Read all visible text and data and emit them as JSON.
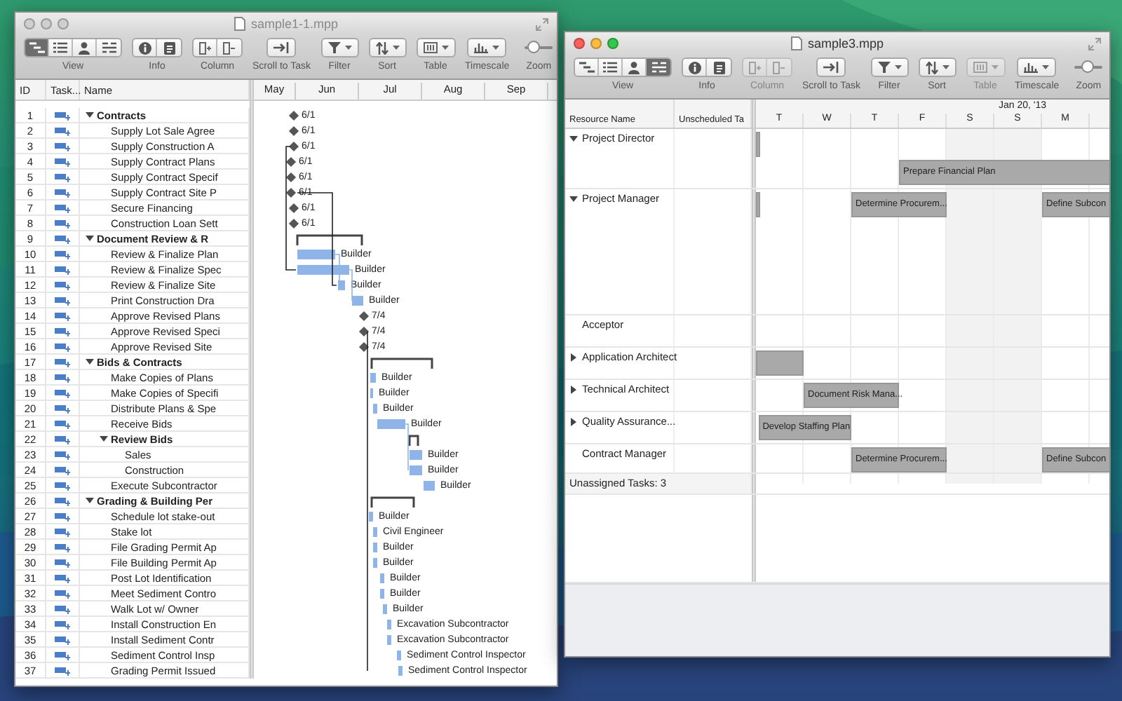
{
  "task_window": {
    "title": "sample1-1.mpp",
    "active": false,
    "toolbar": [
      {
        "kind": "view",
        "label": "View",
        "disabled": false,
        "segments": [
          {
            "selected": true
          },
          {
            "selected": false
          },
          {
            "selected": false
          },
          {
            "selected": false
          }
        ]
      },
      {
        "kind": "info",
        "label": "Info",
        "disabled": false
      },
      {
        "kind": "column",
        "label": "Column",
        "disabled": false
      },
      {
        "kind": "scroll",
        "label": "Scroll to Task",
        "disabled": false
      },
      {
        "kind": "filter",
        "label": "Filter",
        "disabled": false
      },
      {
        "kind": "sort",
        "label": "Sort",
        "disabled": false
      },
      {
        "kind": "table",
        "label": "Table",
        "disabled": false
      },
      {
        "kind": "timescale",
        "label": "Timescale",
        "disabled": false
      },
      {
        "kind": "zoom",
        "label": "Zoom",
        "disabled": false,
        "level": 0.3
      }
    ],
    "columns": [
      "ID",
      "Task...",
      "Name"
    ],
    "months": [
      "May",
      "Jun",
      "Jul",
      "Aug",
      "Sep"
    ],
    "tasks": [
      {
        "id": "1",
        "name": "Contracts",
        "expanded": true,
        "gantt": {
          "kind": "milestone",
          "label": "6/1"
        },
        "children": [
          {
            "id": "2",
            "name": "Supply Lot Sale Agree",
            "gantt": {
              "kind": "milestone",
              "label": "6/1"
            }
          },
          {
            "id": "3",
            "name": "Supply Construction A",
            "gantt": {
              "kind": "milestone",
              "label": "6/1"
            }
          },
          {
            "id": "4",
            "name": "Supply Contract Plans",
            "gantt": {
              "kind": "milestone",
              "label": "6/1"
            }
          },
          {
            "id": "5",
            "name": "Supply Contract Specif",
            "gantt": {
              "kind": "milestone",
              "label": "6/1"
            }
          },
          {
            "id": "6",
            "name": "Supply Contract Site P",
            "gantt": {
              "kind": "milestone",
              "label": "6/1"
            }
          },
          {
            "id": "7",
            "name": "Secure Financing",
            "gantt": {
              "kind": "milestone",
              "label": "6/1"
            }
          },
          {
            "id": "8",
            "name": "Construction Loan Sett",
            "gantt": {
              "kind": "milestone",
              "label": "6/1"
            }
          }
        ]
      },
      {
        "id": "9",
        "name": "Document Review & R",
        "expanded": true,
        "gantt": {
          "kind": "summary"
        },
        "children": [
          {
            "id": "10",
            "name": "Review & Finalize Plan",
            "gantt": {
              "kind": "bar",
              "label": "Builder"
            }
          },
          {
            "id": "11",
            "name": "Review & Finalize Spec",
            "gantt": {
              "kind": "bar",
              "label": "Builder"
            }
          },
          {
            "id": "12",
            "name": "Review & Finalize Site",
            "gantt": {
              "kind": "bar",
              "label": "Builder"
            }
          },
          {
            "id": "13",
            "name": "Print Construction Dra",
            "gantt": {
              "kind": "bar",
              "label": "Builder"
            }
          },
          {
            "id": "14",
            "name": "Approve Revised Plans",
            "gantt": {
              "kind": "milestone",
              "label": "7/4"
            }
          },
          {
            "id": "15",
            "name": "Approve Revised Speci",
            "gantt": {
              "kind": "milestone",
              "label": "7/4"
            }
          },
          {
            "id": "16",
            "name": "Approve Revised Site",
            "gantt": {
              "kind": "milestone",
              "label": "7/4"
            }
          }
        ]
      },
      {
        "id": "17",
        "name": "Bids & Contracts",
        "expanded": true,
        "gantt": {
          "kind": "summary"
        },
        "children": [
          {
            "id": "18",
            "name": "Make Copies of Plans",
            "gantt": {
              "kind": "bar",
              "label": "Builder"
            }
          },
          {
            "id": "19",
            "name": "Make Copies of Specifi",
            "gantt": {
              "kind": "bar",
              "label": "Builder"
            }
          },
          {
            "id": "20",
            "name": "Distribute Plans & Spe",
            "gantt": {
              "kind": "bar",
              "label": "Builder"
            }
          },
          {
            "id": "21",
            "name": "Receive Bids",
            "gantt": {
              "kind": "bar",
              "label": "Builder"
            }
          },
          {
            "id": "22",
            "name": "Review Bids",
            "expanded": true,
            "gantt": {
              "kind": "summary"
            },
            "children": [
              {
                "id": "23",
                "name": "Sales",
                "gantt": {
                  "kind": "bar",
                  "label": "Builder"
                }
              },
              {
                "id": "24",
                "name": "Construction",
                "gantt": {
                  "kind": "bar",
                  "label": "Builder"
                }
              }
            ]
          },
          {
            "id": "25",
            "name": "Execute Subcontractor",
            "gantt": {
              "kind": "bar",
              "label": "Builder"
            }
          }
        ]
      },
      {
        "id": "26",
        "name": "Grading & Building Per",
        "expanded": true,
        "gantt": {
          "kind": "summary"
        },
        "children": [
          {
            "id": "27",
            "name": "Schedule lot stake-out",
            "gantt": {
              "kind": "bar",
              "label": "Builder"
            }
          },
          {
            "id": "28",
            "name": "Stake lot",
            "gantt": {
              "kind": "bar",
              "label": "Civil Engineer"
            }
          },
          {
            "id": "29",
            "name": "File Grading Permit Ap",
            "gantt": {
              "kind": "bar",
              "label": "Builder"
            }
          },
          {
            "id": "30",
            "name": "File Building Permit Ap",
            "gantt": {
              "kind": "bar",
              "label": "Builder"
            }
          },
          {
            "id": "31",
            "name": "Post Lot Identification",
            "gantt": {
              "kind": "bar",
              "label": "Builder"
            }
          },
          {
            "id": "32",
            "name": "Meet Sediment Contro",
            "gantt": {
              "kind": "bar",
              "label": "Builder"
            }
          },
          {
            "id": "33",
            "name": "Walk Lot w/ Owner",
            "gantt": {
              "kind": "bar",
              "label": "Builder"
            }
          },
          {
            "id": "34",
            "name": "Install Construction En",
            "gantt": {
              "kind": "bar",
              "label": "Excavation Subcontractor"
            }
          },
          {
            "id": "35",
            "name": "Install Sediment Contr",
            "gantt": {
              "kind": "bar",
              "label": "Excavation Subcontractor"
            }
          },
          {
            "id": "36",
            "name": "Sediment Control Insp",
            "gantt": {
              "kind": "bar",
              "label": "Sediment Control Inspector"
            }
          },
          {
            "id": "37",
            "name": "Grading Permit Issued",
            "gantt": {
              "kind": "bar",
              "label": "Sediment Control Inspector"
            }
          }
        ]
      }
    ]
  },
  "resource_window": {
    "title": "sample3.mpp",
    "active": true,
    "toolbar": [
      {
        "kind": "view",
        "label": "View",
        "disabled": false,
        "segments": [
          {
            "selected": false
          },
          {
            "selected": false
          },
          {
            "selected": false
          },
          {
            "selected": true
          }
        ]
      },
      {
        "kind": "info",
        "label": "Info",
        "disabled": false
      },
      {
        "kind": "column",
        "label": "Column",
        "disabled": true
      },
      {
        "kind": "scroll",
        "label": "Scroll to Task",
        "disabled": false
      },
      {
        "kind": "filter",
        "label": "Filter",
        "disabled": false
      },
      {
        "kind": "sort",
        "label": "Sort",
        "disabled": false
      },
      {
        "kind": "table",
        "label": "Table",
        "disabled": true
      },
      {
        "kind": "timescale",
        "label": "Timescale",
        "disabled": false
      },
      {
        "kind": "zoom",
        "label": "Zoom",
        "disabled": false,
        "level": 0.45
      }
    ],
    "columns": [
      "Resource Name",
      "Unscheduled Ta"
    ],
    "week_label": "Jan 20, '13",
    "days": [
      {
        "label": "T",
        "weekend": false
      },
      {
        "label": "W",
        "weekend": false
      },
      {
        "label": "T",
        "weekend": false
      },
      {
        "label": "F",
        "weekend": false
      },
      {
        "label": "S",
        "weekend": true
      },
      {
        "label": "S",
        "weekend": true
      },
      {
        "label": "M",
        "weekend": false
      }
    ],
    "resources": [
      {
        "name": "Project Director",
        "kind": "group",
        "expanded": true,
        "bars": [
          {
            "kind": "sliver"
          },
          {
            "kind": "bar",
            "label": "Prepare Financial Plan"
          }
        ]
      },
      {
        "name": "Project Manager",
        "kind": "group",
        "expanded": true,
        "bars": [
          {
            "kind": "sliver"
          },
          {
            "kind": "bar",
            "label": "Determine Procurem..."
          },
          {
            "kind": "bar",
            "label": "Define Subcon"
          }
        ]
      },
      {
        "name": "Acceptor",
        "kind": "resource"
      },
      {
        "name": "Application Architect",
        "kind": "group",
        "expanded": false,
        "bars": [
          {
            "kind": "bar"
          }
        ]
      },
      {
        "name": "Technical Architect",
        "kind": "group",
        "expanded": false,
        "bars": [
          {
            "kind": "bar",
            "label": "Document Risk Mana..."
          }
        ]
      },
      {
        "name": "Quality Assurance...",
        "kind": "group",
        "expanded": false,
        "bars": [
          {
            "kind": "bar",
            "label": "Develop Staffing Plan"
          }
        ]
      },
      {
        "name": "Contract Manager",
        "kind": "resource",
        "bars": [
          {
            "kind": "bar",
            "label": "Determine Procurem..."
          },
          {
            "kind": "bar",
            "label": "Define Subcon"
          }
        ]
      }
    ],
    "unassigned": "Unassigned Tasks: 3"
  }
}
